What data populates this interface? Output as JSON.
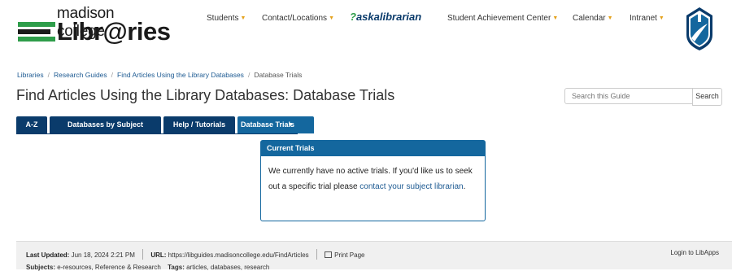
{
  "header": {
    "logo_line1": "madison college",
    "logo_line2": "Libr@ries",
    "logo_bar_colors": [
      "#2e9d4a",
      "#1a1a1a",
      "#2e9d4a"
    ],
    "nav": [
      {
        "label": "Students",
        "has_dropdown": true
      },
      {
        "label": "Contact/Locations",
        "has_dropdown": true
      },
      {
        "label": "askalibrarian",
        "prefix": "?",
        "has_dropdown": false
      },
      {
        "label": "Student Achievement Center",
        "has_dropdown": true
      },
      {
        "label": "Calendar",
        "has_dropdown": true
      },
      {
        "label": "Intranet",
        "has_dropdown": true
      }
    ],
    "crest_icon": "madison-college-crest-icon"
  },
  "breadcrumb": [
    "Libraries",
    "Research Guides",
    "Find Articles Using the Library Databases",
    "Database Trials"
  ],
  "page_title": "Find Articles Using the Library Databases: Database Trials",
  "search": {
    "placeholder": "Search this Guide",
    "button_label": "Search"
  },
  "tabs": [
    {
      "label": "A-Z",
      "active": false
    },
    {
      "label": "Databases by Subject",
      "active": false
    },
    {
      "label": "Help / Tutorials",
      "active": false
    },
    {
      "label": "Database Trials",
      "active": true,
      "has_dropdown": true
    }
  ],
  "panel": {
    "title": "Current Trials",
    "text_before": "We currently have no active trials. If you'd like us to seek out a specific trial please ",
    "link_text": "contact your subject librarian",
    "text_after": "."
  },
  "footer": {
    "last_updated_label": "Last Updated:",
    "last_updated_value": "Jun 18, 2024 2:21 PM",
    "url_label": "URL:",
    "url_value": "https://libguides.madisoncollege.edu/FindArticles",
    "print_label": "Print Page",
    "login_label": "Login to LibApps",
    "subjects_label": "Subjects:",
    "subjects_value": "e-resources, Reference & Research",
    "tags_label": "Tags:",
    "tags_value": "articles, databases, research"
  },
  "colors": {
    "navy": "#0a3b6b",
    "blue": "#14679e",
    "link": "#1d5a92",
    "accent_gold": "#e4a11b",
    "green": "#2e9d4a"
  }
}
